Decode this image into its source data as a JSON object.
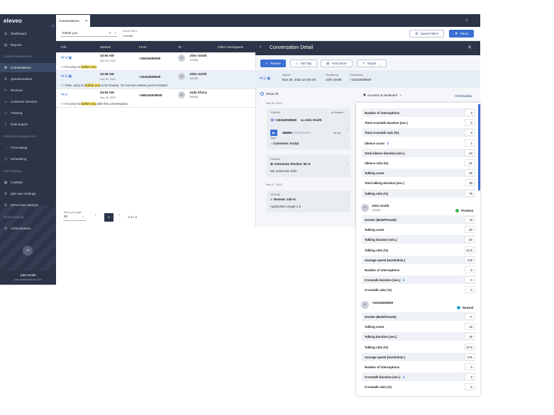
{
  "app": {
    "logo": "eleveo"
  },
  "sidebar": {
    "collapse_icon": "‹",
    "items": [
      {
        "label": "Dashboard",
        "icon": "dashboard-icon"
      },
      {
        "label": "Reports",
        "icon": "reports-icon"
      },
      {
        "label": "Conversations",
        "icon": "conversations-icon",
        "active": true
      },
      {
        "label": "Questionnaires",
        "icon": "questionnaire-icon"
      },
      {
        "label": "Reviews",
        "icon": "reviews-icon"
      },
      {
        "label": "Customer Surveys",
        "icon": "survey-icon"
      },
      {
        "label": "Training",
        "icon": "training-icon"
      },
      {
        "label": "Data Export",
        "icon": "export-icon"
      },
      {
        "label": "Forecasting",
        "icon": "forecast-icon"
      },
      {
        "label": "Scheduling",
        "icon": "schedule-icon"
      },
      {
        "label": "LiveMon",
        "icon": "livemon-icon"
      },
      {
        "label": "QM User Settings",
        "icon": "settings-icon"
      },
      {
        "label": "WFM User Settings",
        "icon": "settings-icon"
      },
      {
        "label": "Administration",
        "icon": "admin-icon"
      }
    ],
    "sections": [
      "Quality Management",
      "Workforce Management",
      "User Settings",
      "Global Settings"
    ],
    "user": {
      "initials": "JS",
      "name": "John Smith",
      "email": "john.smith@eleveo.com"
    }
  },
  "tabs": [
    {
      "label": "Conversations",
      "close": "✕"
    }
  ],
  "filters": {
    "search_value": "bother you",
    "active_filters_label": "Active filters",
    "active_filters_value": "3 results",
    "saved_filters": "Saved Filters",
    "filters": "Filters"
  },
  "table": {
    "headers": [
      "Info",
      "Started",
      "From",
      "To",
      "Other Participants"
    ],
    "rows": [
      {
        "time": "10:50 AM",
        "date": "Nov 26, 2022",
        "from": "+19615499949",
        "initials": "JS",
        "to_name": "John Smith",
        "to_id": "123456",
        "snippet_pre": "I'm sorry to ",
        "snippet_hl": "bother you",
        "snippet_post": ".",
        "selected": false
      },
      {
        "time": "10:48 AM",
        "date": "Nov 26, 2022",
        "from": "+16154939949",
        "initials": "JS",
        "to_name": "John Smith",
        "to_id": "123456",
        "snippet_pre": "Yeah, sorry to ",
        "snippet_hl": "bother you",
        "snippet_post": " to be honest, I'm not sure where you're located.",
        "selected": true
      },
      {
        "time": "04:56 AM",
        "date": "Nov 25, 2022",
        "from": "+496154939949",
        "initials": "JK",
        "to_name": "Judy Khory",
        "to_id": "845898",
        "snippet_pre": "I'm sorry to ",
        "snippet_hl": "bother you",
        "snippet_post": " with this conversation.",
        "selected": false
      }
    ]
  },
  "pager": {
    "label": "Items per page",
    "per_page": "20",
    "current": "1",
    "range": "1-3 / 3"
  },
  "detail": {
    "title": "Conversation Detail",
    "buttons": [
      "Review",
      "Add Tag",
      "Anonymize",
      "Export"
    ],
    "started_label": "Started",
    "started_value": "Nov 26, 2022 10:48 AM",
    "handled_label": "Handled by",
    "handled_value": "John Smith",
    "participants_label": "Participants",
    "participants_value": "+16154939949",
    "show_all": "Show All",
    "acoustic": "Acoustic & sentiment",
    "all_metadata": "All Metadata",
    "timeline": [
      {
        "date": "Nov 26, 2022"
      },
      {
        "date": "Nov 27, 2022"
      }
    ],
    "card1": {
      "time": "10:48 AM",
      "protected": "Protected",
      "phone": "+16154939949",
      "agent": "John Smith",
      "duration": "48 sec",
      "progress": 0.33,
      "tags_label": "Tags",
      "comment": "Comment: Script"
    },
    "card2": {
      "time": "10:50 AM",
      "title": "Automatic Review: 55 %",
      "subtitle": "My Automatic Rule"
    },
    "card3": {
      "time": "09:03 AM",
      "title": "Review: 100 %",
      "subtitle": "Application usage 1.0"
    }
  },
  "metadata": {
    "general": [
      {
        "label": "Number of interruptions",
        "value": "0"
      },
      {
        "label": "Total crosstalk duration (sec.)",
        "value": "0"
      },
      {
        "label": "Total crosstalk ratio (%)",
        "value": "0"
      },
      {
        "label": "Silence count",
        "value": "1",
        "info": true
      },
      {
        "label": "Total silence duration (sec.)",
        "value": "10"
      },
      {
        "label": "Silence ratio (%)",
        "value": "21"
      },
      {
        "label": "Talking count",
        "value": "35"
      },
      {
        "label": "Total talking duration (sec.)",
        "value": "38"
      },
      {
        "label": "Talking ratio (%)",
        "value": "79"
      }
    ],
    "speaker1": {
      "initials": "JS",
      "name": "John Smith",
      "id": "123456",
      "sentiment": "Positive",
      "sentiment_color": "#3cb44b",
      "rows": [
        {
          "label": "Gender (Male/Female)",
          "value": "M"
        },
        {
          "label": "Talking count",
          "value": "20"
        },
        {
          "label": "Talking duration (sec.)",
          "value": "20"
        },
        {
          "label": "Talking ratio (%)",
          "value": "41,6"
        },
        {
          "label": "Average speed (words/min.)",
          "value": "128"
        },
        {
          "label": "Number of interruptions",
          "value": "0"
        },
        {
          "label": "Crosstalk duration (sec.)",
          "value": "0",
          "info": true
        },
        {
          "label": "Crosstalk ratio (%)",
          "value": "0"
        }
      ]
    },
    "speaker2": {
      "name": "+16154939949",
      "sentiment": "Neutral",
      "sentiment_color": "#2a9fd6",
      "rows": [
        {
          "label": "Gender (Male/Female)",
          "value": "F"
        },
        {
          "label": "Talking count",
          "value": "15"
        },
        {
          "label": "Talking duration (sec.)",
          "value": "18"
        },
        {
          "label": "Talking ratio (%)",
          "value": "37,5"
        },
        {
          "label": "Average speed (words/min.)",
          "value": "145"
        },
        {
          "label": "Number of interruptions",
          "value": "0"
        },
        {
          "label": "Crosstalk duration (sec.)",
          "value": "0",
          "info": true
        },
        {
          "label": "Crosstalk ratio (%)",
          "value": "0"
        }
      ]
    }
  }
}
